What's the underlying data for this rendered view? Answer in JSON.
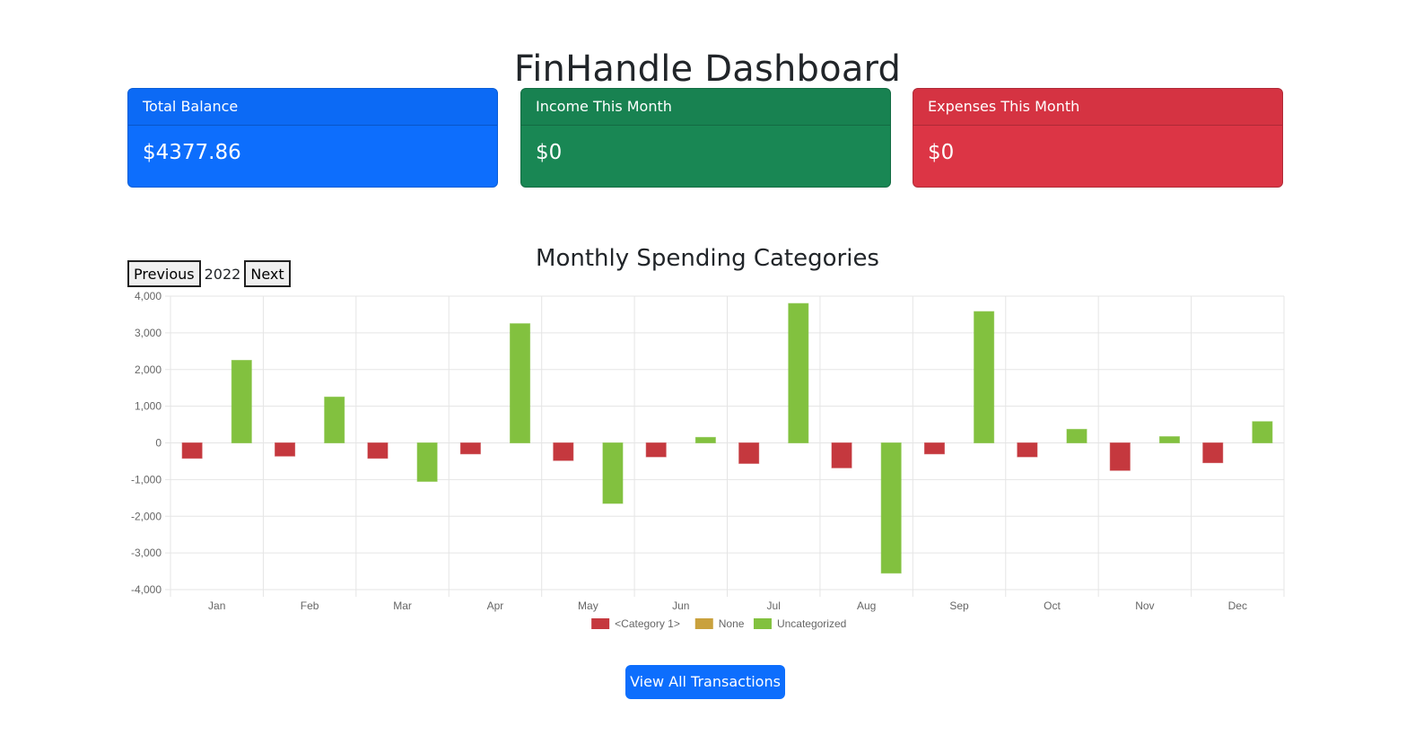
{
  "header": {
    "title": "FinHandle Dashboard"
  },
  "cards": {
    "balance": {
      "label": "Total Balance",
      "value": "$4377.86",
      "color": "#0d6efd"
    },
    "income": {
      "label": "Income This Month",
      "value": "$0",
      "color": "#198754"
    },
    "expenses": {
      "label": "Expenses This Month",
      "value": "$0",
      "color": "#dc3545"
    }
  },
  "chart_section": {
    "title": "Monthly Spending Categories",
    "prev_label": "Previous",
    "year": "2022",
    "next_label": "Next"
  },
  "chart_data": {
    "type": "bar",
    "categories": [
      "Jan",
      "Feb",
      "Mar",
      "Apr",
      "May",
      "Jun",
      "Jul",
      "Aug",
      "Sep",
      "Oct",
      "Nov",
      "Dec"
    ],
    "series": [
      {
        "name": "<Category 1>",
        "color": "#c5383e",
        "values": [
          -420,
          -360,
          -420,
          -300,
          -480,
          -380,
          -560,
          -680,
          -300,
          -380,
          -750,
          -540
        ]
      },
      {
        "name": "None",
        "color": "#c9a13d",
        "values": [
          0,
          0,
          0,
          0,
          0,
          0,
          0,
          0,
          0,
          0,
          0,
          0
        ]
      },
      {
        "name": "Uncategorized",
        "color": "#82c13f",
        "values": [
          2250,
          1250,
          -1050,
          3250,
          -1650,
          150,
          3800,
          -3550,
          3580,
          370,
          170,
          580
        ]
      }
    ],
    "ylim": [
      -4000,
      4000
    ],
    "yticks": [
      "4,000",
      "3,000",
      "2,000",
      "1,000",
      "0",
      "-1,000",
      "-2,000",
      "-3,000",
      "-4,000"
    ],
    "grid": true,
    "legend": "bottom"
  },
  "actions": {
    "view_all_label": "View All Transactions"
  }
}
